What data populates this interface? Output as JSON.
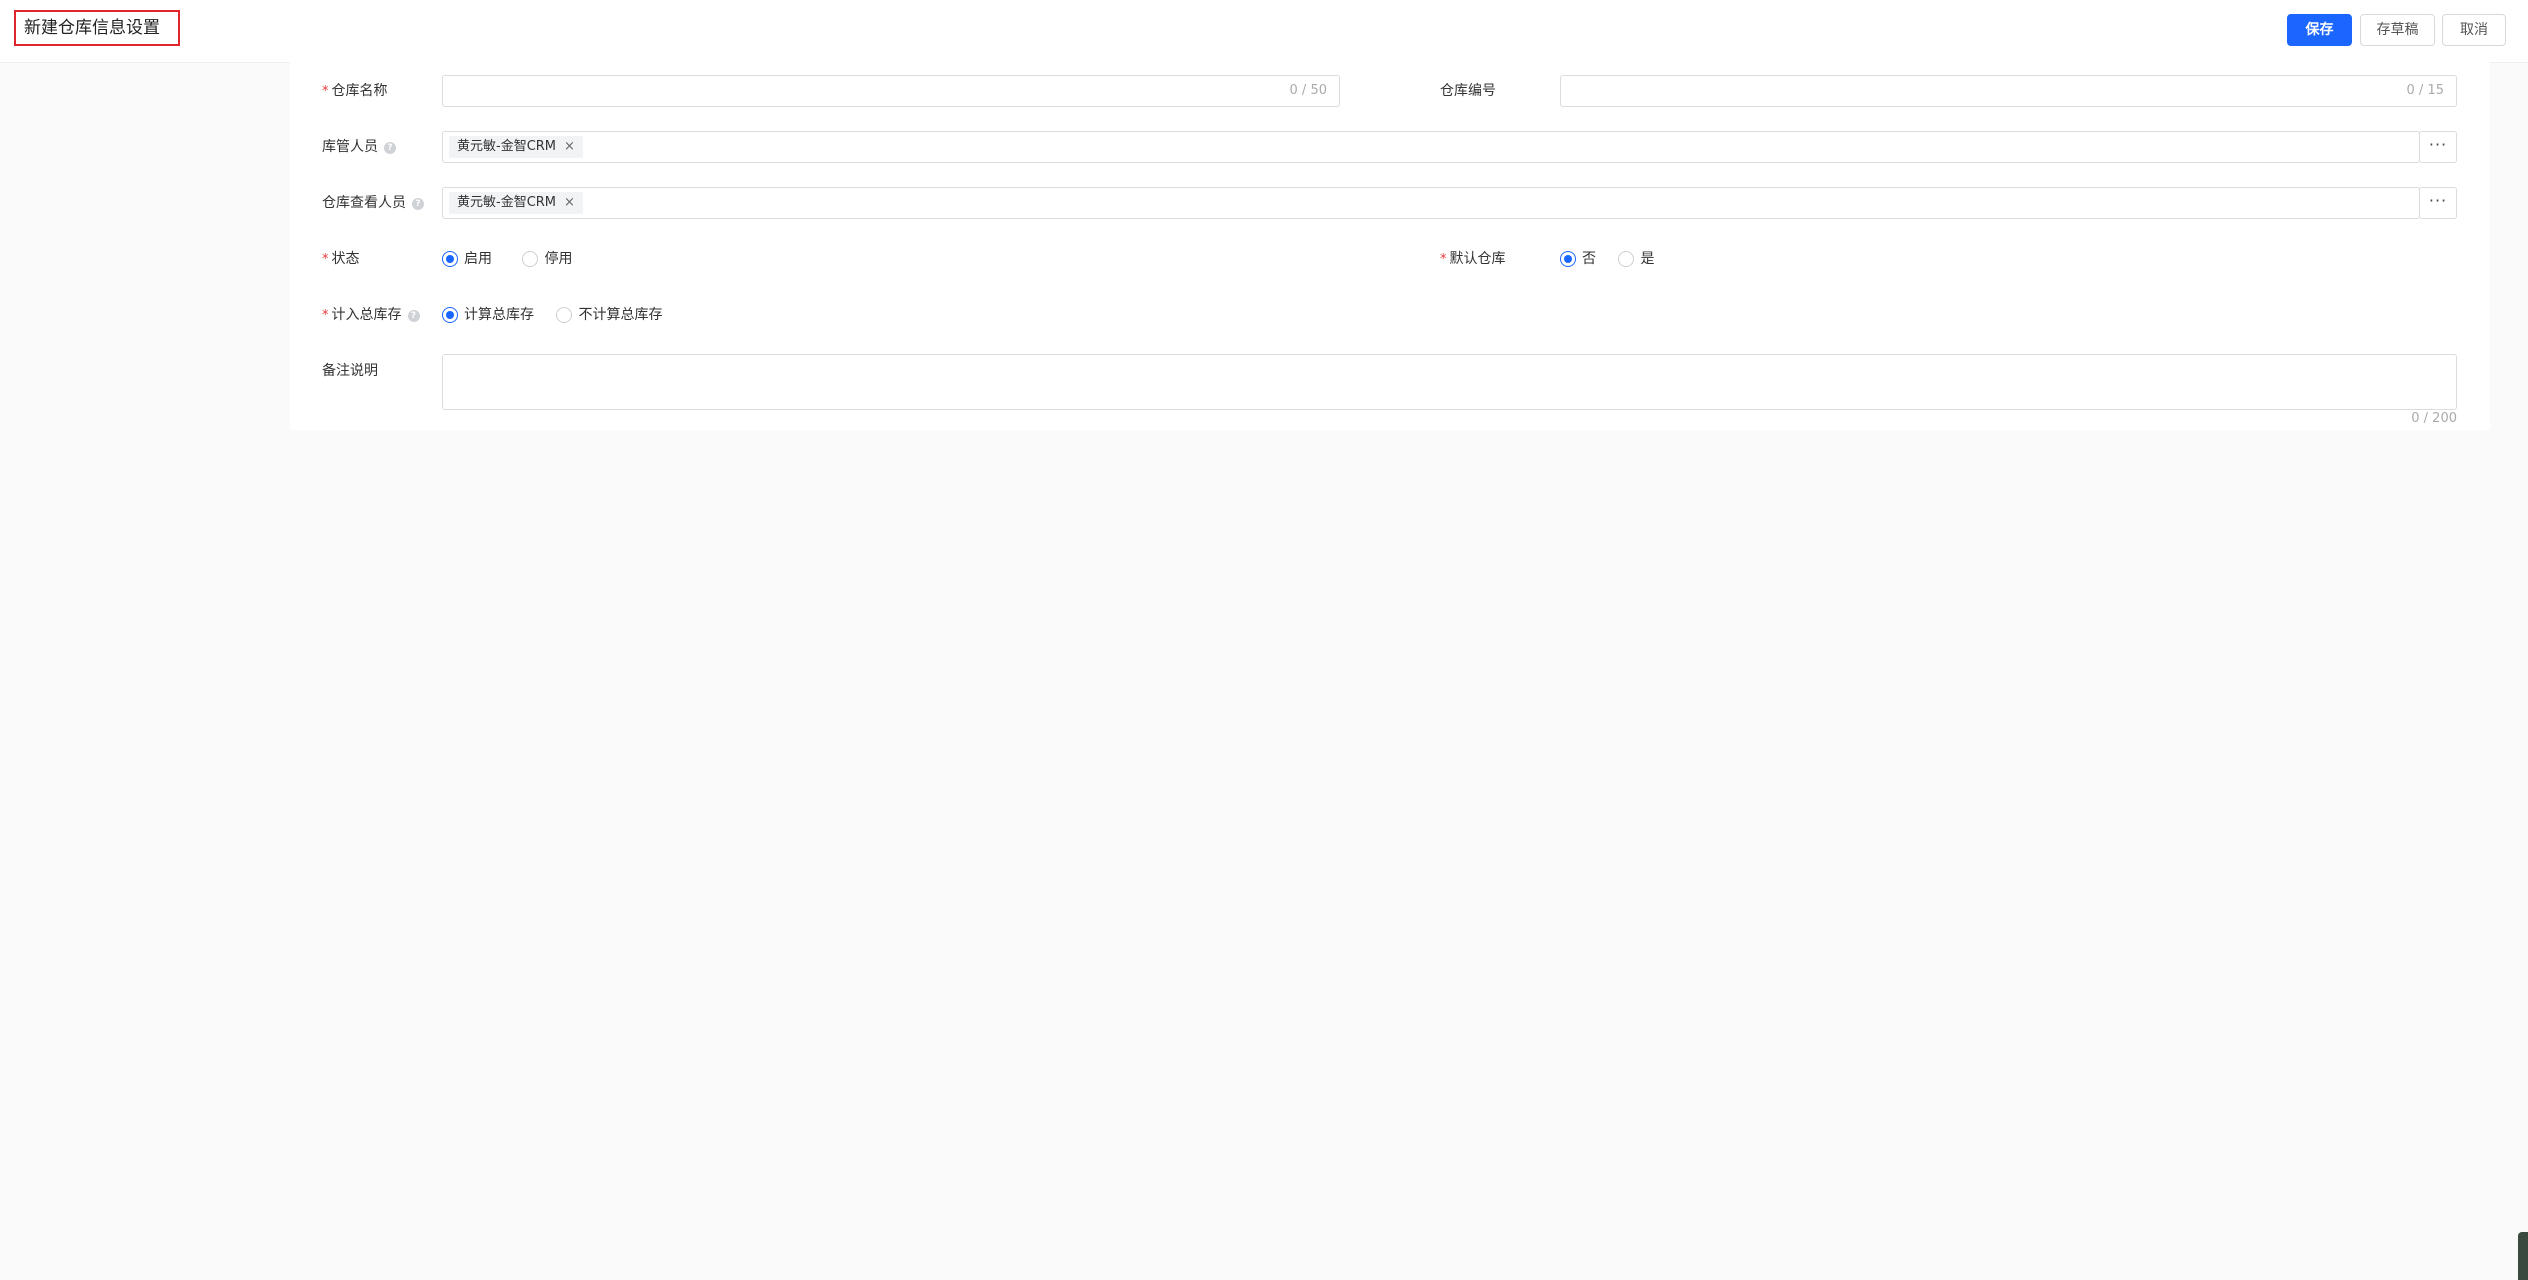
{
  "header": {
    "title": "新建仓库信息设置",
    "save_label": "保存",
    "draft_label": "存草稿",
    "cancel_label": "取消"
  },
  "form": {
    "warehouse_name": {
      "label": "仓库名称",
      "required": true,
      "value": "",
      "counter": "0 / 50"
    },
    "warehouse_code": {
      "label": "仓库编号",
      "required": false,
      "value": "",
      "counter": "0 / 15"
    },
    "keeper": {
      "label": "库管人员",
      "tags": [
        "黄元敏-金智CRM"
      ],
      "more": "···"
    },
    "viewer": {
      "label": "仓库查看人员",
      "tags": [
        "黄元敏-金智CRM"
      ],
      "more": "···"
    },
    "status": {
      "label": "状态",
      "required": true,
      "options": [
        "启用",
        "停用"
      ],
      "selected": "启用"
    },
    "default_warehouse": {
      "label": "默认仓库",
      "required": true,
      "options": [
        "否",
        "是"
      ],
      "selected": "否"
    },
    "include_total": {
      "label": "计入总库存",
      "required": true,
      "options": [
        "计算总库存",
        "不计算总库存"
      ],
      "selected": "计算总库存"
    },
    "remark": {
      "label": "备注说明",
      "value": "",
      "counter": "0 / 200"
    }
  },
  "icons": {
    "required": "asterisk-icon",
    "help": "question-circle-icon",
    "tag_remove": "close-icon",
    "more": "ellipsis-icon"
  },
  "colors": {
    "primary": "#1a66ff",
    "required": "#e53935",
    "highlight_border": "#e0262b"
  }
}
